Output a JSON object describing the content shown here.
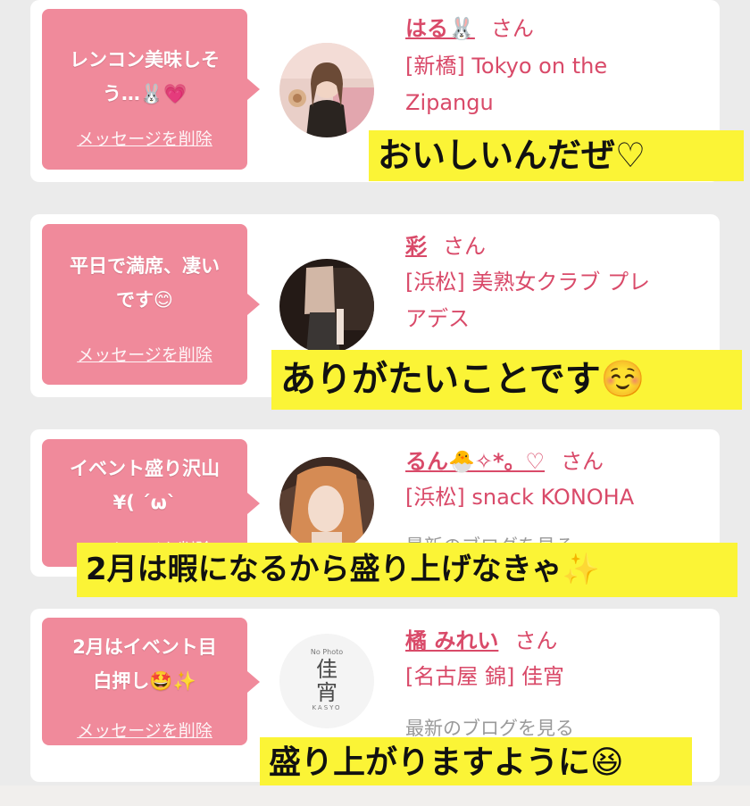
{
  "cards": [
    {
      "bubble_lines": [
        "レンコン美味しそ",
        "う…🐰💗"
      ],
      "delete_label": "メッセージを削除",
      "name": "はる🐰",
      "san": "さん",
      "shop_lines": [
        "[新橋] Tokyo on the",
        "Zipangu"
      ],
      "blog_label": "",
      "caption": "おいしいんだぜ♡"
    },
    {
      "bubble_lines": [
        "平日で満席、凄い",
        "です😊"
      ],
      "delete_label": "メッセージを削除",
      "name": "彩",
      "san": "さん",
      "shop_lines": [
        "[浜松] 美熟女クラブ プレ",
        "アデス"
      ],
      "blog_label": "",
      "caption": "ありがたいことです☺️"
    },
    {
      "bubble_lines": [
        "イベント盛り沢山",
        "¥( ´ω`"
      ],
      "delete_label": "メッセージを削除",
      "name": "るん🐣✧*。♡",
      "san": "さん",
      "shop_lines": [
        "[浜松] snack KONOHA"
      ],
      "blog_label": "最新のブログを見る",
      "caption": "2月は暇になるから盛り上げなきゃ✨"
    },
    {
      "bubble_lines": [
        "2月はイベント目",
        "白押し🤩✨"
      ],
      "delete_label": "メッセージを削除",
      "name": "橘 みれい",
      "san": "さん",
      "shop_lines": [
        "[名古屋 錦] 佳宵"
      ],
      "blog_label": "最新のブログを見る",
      "caption": "盛り上がりますように😆",
      "no_photo_label": "No Photo",
      "logo_text": "佳宵",
      "logo_sub": "KASYO"
    }
  ],
  "colors": {
    "pink_bubble": "#f08a9b",
    "name_pink": "#d94a69",
    "caption_yellow": "#fbf436",
    "background": "#ebebeb"
  }
}
